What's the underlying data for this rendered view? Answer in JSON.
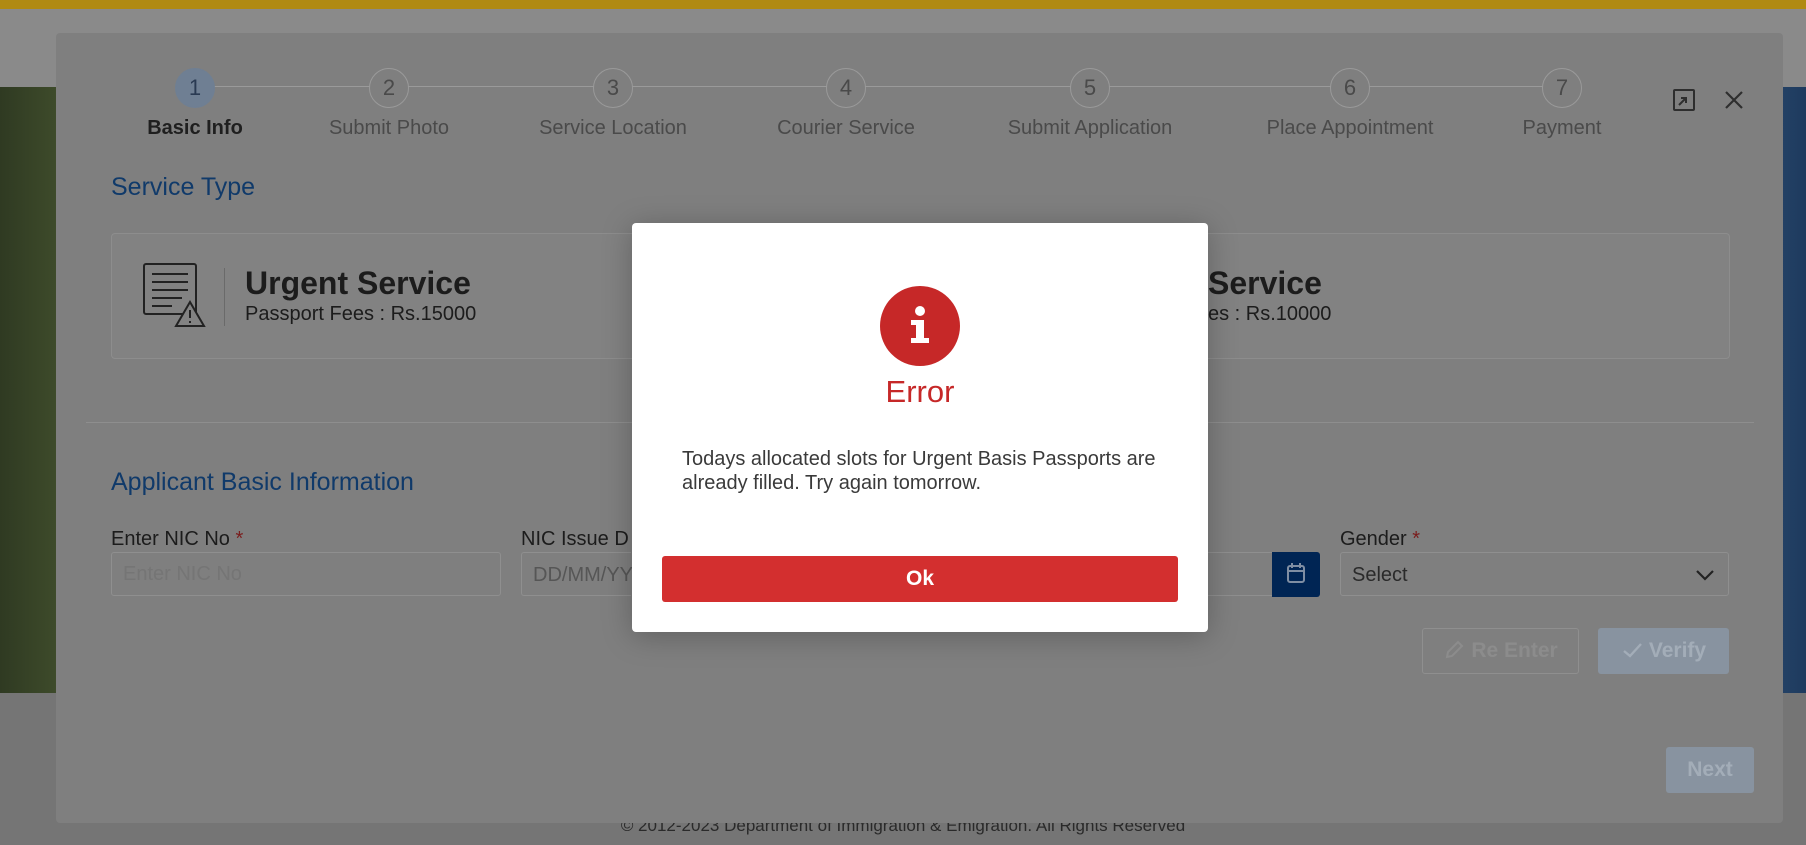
{
  "footer": {
    "copyright": "© 2012-2023 Department of Immigration & Emigration. All Rights Reserved"
  },
  "wizard": {
    "steps": [
      {
        "number": "1",
        "label": "Basic Info"
      },
      {
        "number": "2",
        "label": "Submit Photo"
      },
      {
        "number": "3",
        "label": "Service Location"
      },
      {
        "number": "4",
        "label": "Courier Service"
      },
      {
        "number": "5",
        "label": "Submit Application"
      },
      {
        "number": "6",
        "label": "Place Appointment"
      },
      {
        "number": "7",
        "label": "Payment"
      }
    ],
    "active_step": 1,
    "icons": {
      "expand": "expand-icon",
      "close": "close-icon"
    }
  },
  "service_type": {
    "title": "Service Type",
    "urgent": {
      "title": "Urgent Service",
      "fee": "Passport Fees : Rs.15000"
    },
    "normal": {
      "title_visible": "Service",
      "fee_visible": "es : Rs.10000"
    }
  },
  "applicant": {
    "title": "Applicant Basic Information",
    "nic_label": "Enter NIC No",
    "nic_placeholder": "Enter NIC No",
    "nic_issue_label": "NIC Issue D",
    "nic_issue_placeholder": "DD/MM/YY",
    "gender_label": "Gender",
    "gender_value": "Select",
    "required_mark": "*",
    "reenter_label": "Re Enter",
    "verify_label": "Verify",
    "next_label": "Next"
  },
  "dialog": {
    "title": "Error",
    "message": "Todays allocated slots for Urgent Basis Passports are already filled. Try again tomorrow.",
    "ok_label": "Ok",
    "icon": "info-icon",
    "accent_color": "#c62828",
    "button_color": "#d32f2f"
  }
}
